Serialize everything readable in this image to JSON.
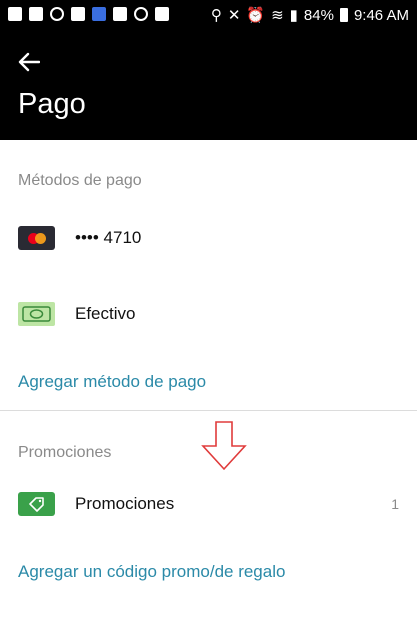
{
  "status_bar": {
    "battery": "84%",
    "time": "9:46 AM"
  },
  "header": {
    "title": "Pago"
  },
  "payment_methods": {
    "section_label": "Métodos de pago",
    "items": [
      {
        "label": "•••• 4710",
        "icon": "mastercard-icon"
      },
      {
        "label": "Efectivo",
        "icon": "cash-icon"
      }
    ],
    "add_link": "Agregar método de pago"
  },
  "promotions": {
    "section_label": "Promociones",
    "item_label": "Promociones",
    "item_count": "1",
    "add_link": "Agregar un código promo/de regalo"
  },
  "colors": {
    "header_bg": "#000000",
    "link": "#2b8aa8",
    "section_label": "#8a8a8a",
    "promo_icon": "#3aa14a",
    "cash_icon": "#bde5a4",
    "annotation_arrow": "#e03b3b"
  }
}
